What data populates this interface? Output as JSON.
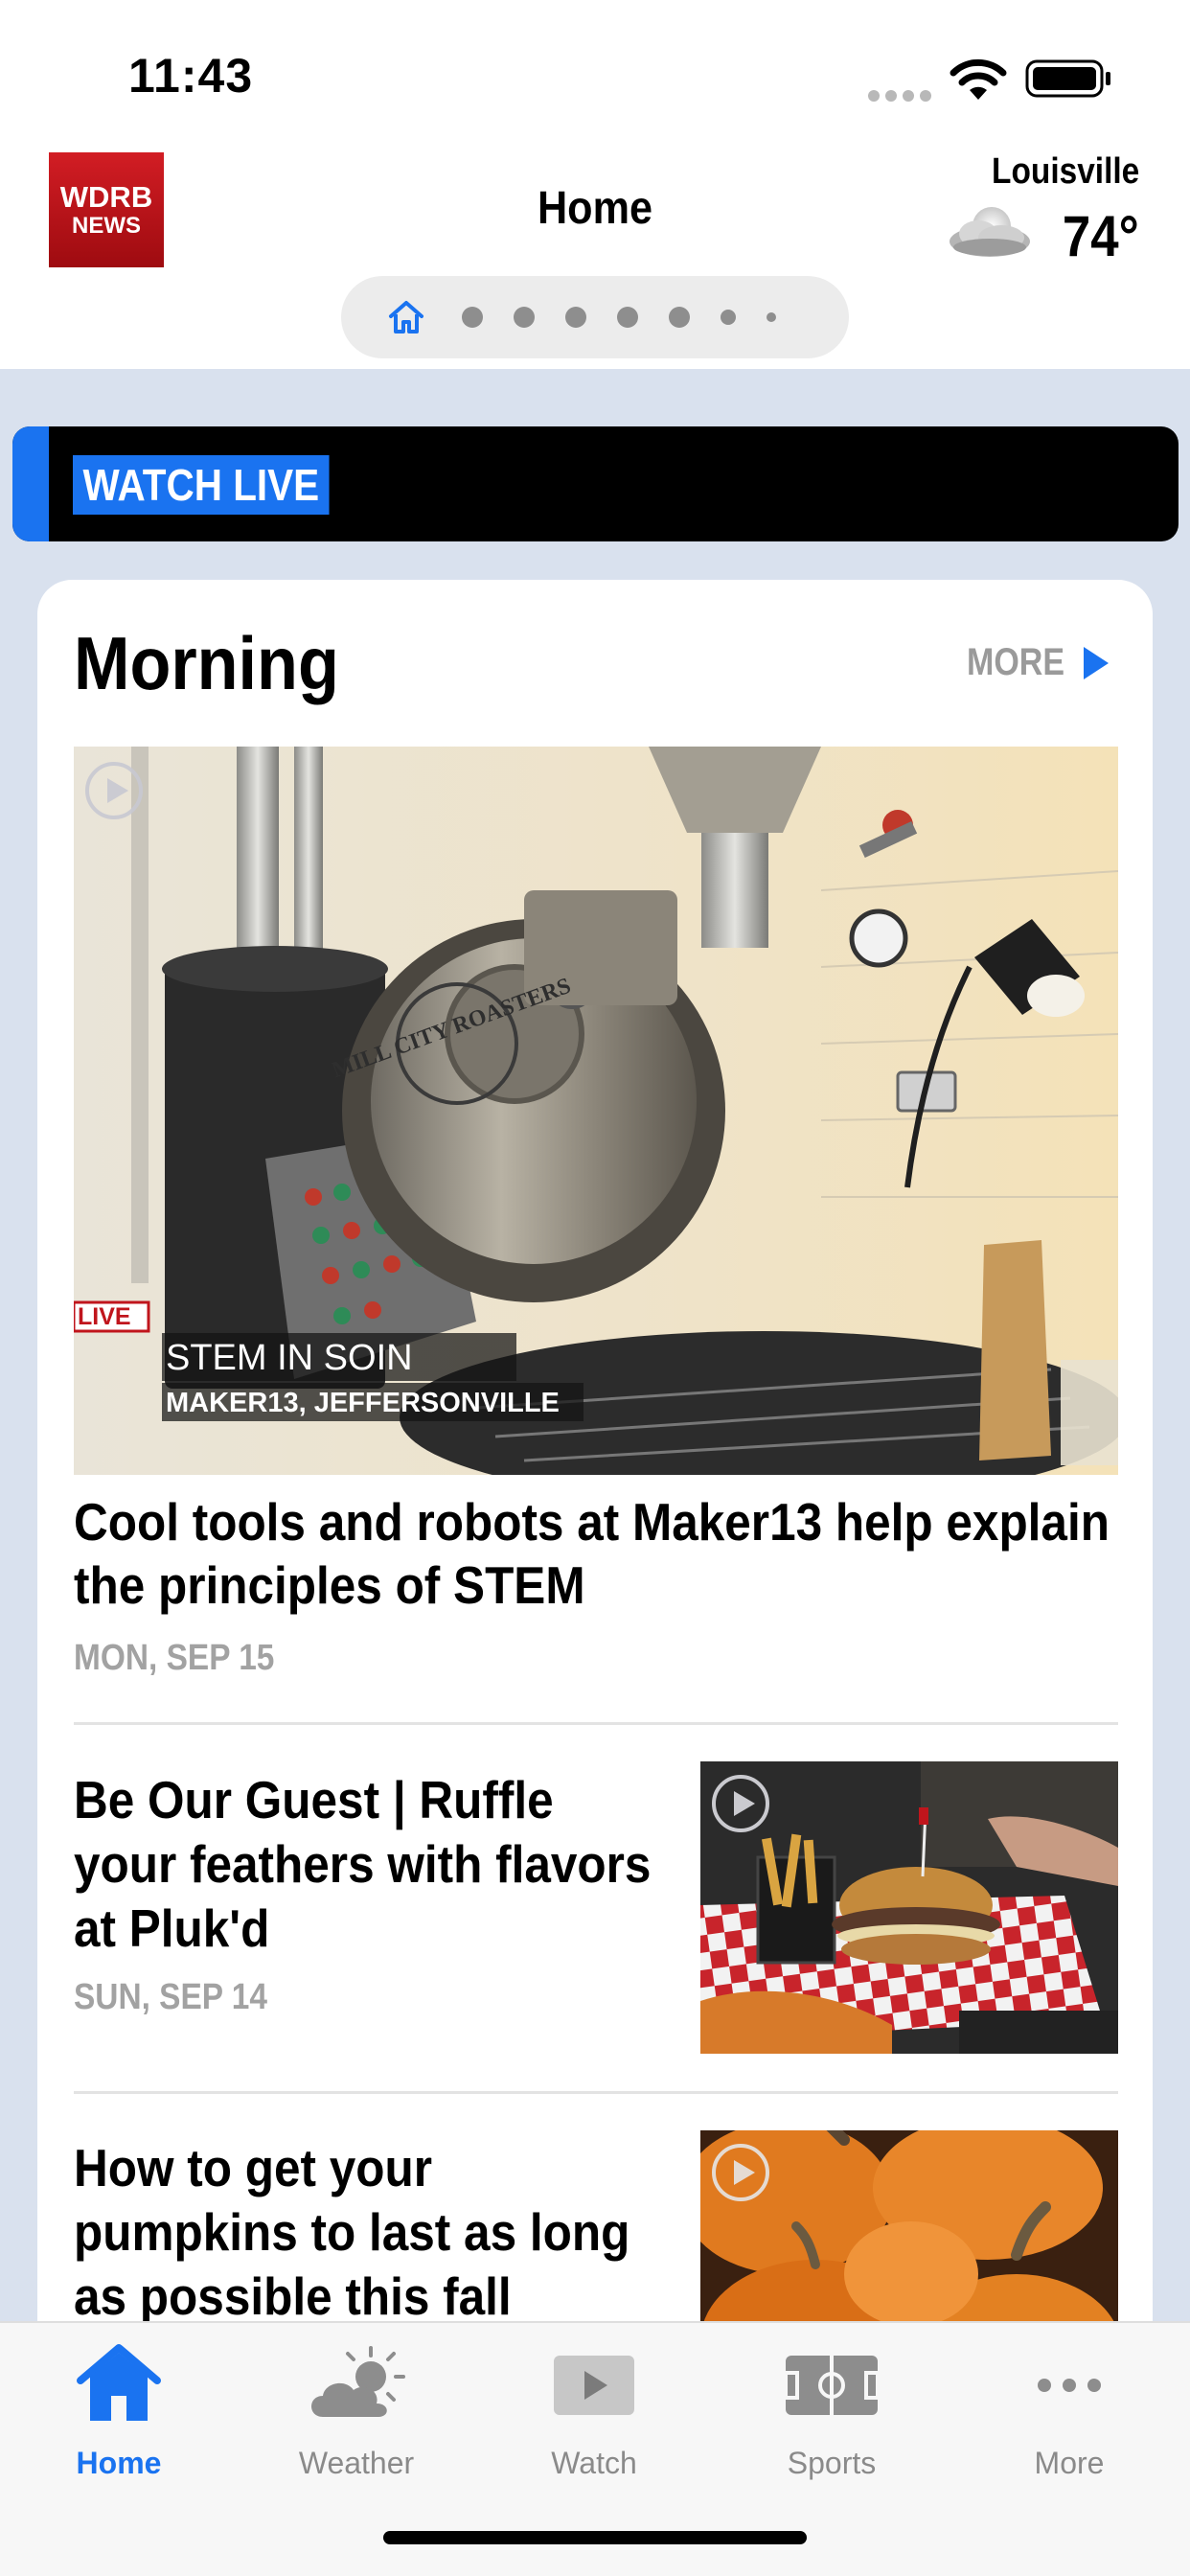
{
  "status_bar": {
    "time": "11:43"
  },
  "header": {
    "logo_line1": "WDRB",
    "logo_line2": "NEWS",
    "title": "Home",
    "city": "Louisville",
    "temperature": "74°",
    "weather_icon": "partly-cloudy-icon",
    "pager_pages": 8,
    "pager_active_index": 0
  },
  "live_bar": {
    "label": "WATCH LIVE"
  },
  "section": {
    "title": "Morning",
    "more_label": "MORE"
  },
  "articles": [
    {
      "headline": "Cool tools and robots at Maker13 help explain the principles of STEM",
      "date": "MON, SEP 15",
      "has_video": true,
      "overlay_badge": "LIVE",
      "overlay_line1": "STEM IN SOIN",
      "overlay_line2": "MAKER13, JEFFERSONVILLE",
      "sign_text": "MILL CITY ROASTERS"
    },
    {
      "headline": "Be Our Guest | Ruffle your feathers with flavors at Pluk'd",
      "date": "SUN, SEP 14",
      "has_video": true
    },
    {
      "headline": "How to get your pumpkins to last as long as possible this fall",
      "has_video": true
    }
  ],
  "tab_bar": {
    "tabs": [
      {
        "label": "Home",
        "icon": "house-icon",
        "active": true
      },
      {
        "label": "Weather",
        "icon": "cloud-sun-icon",
        "active": false
      },
      {
        "label": "Watch",
        "icon": "play-icon",
        "active": false
      },
      {
        "label": "Sports",
        "icon": "field-icon",
        "active": false
      },
      {
        "label": "More",
        "icon": "ellipsis-icon",
        "active": false
      }
    ]
  },
  "colors": {
    "accent": "#1a73f0",
    "brand_red": "#c0151c",
    "background": "#d9e1ee",
    "date_gray": "#a2a2a2"
  }
}
